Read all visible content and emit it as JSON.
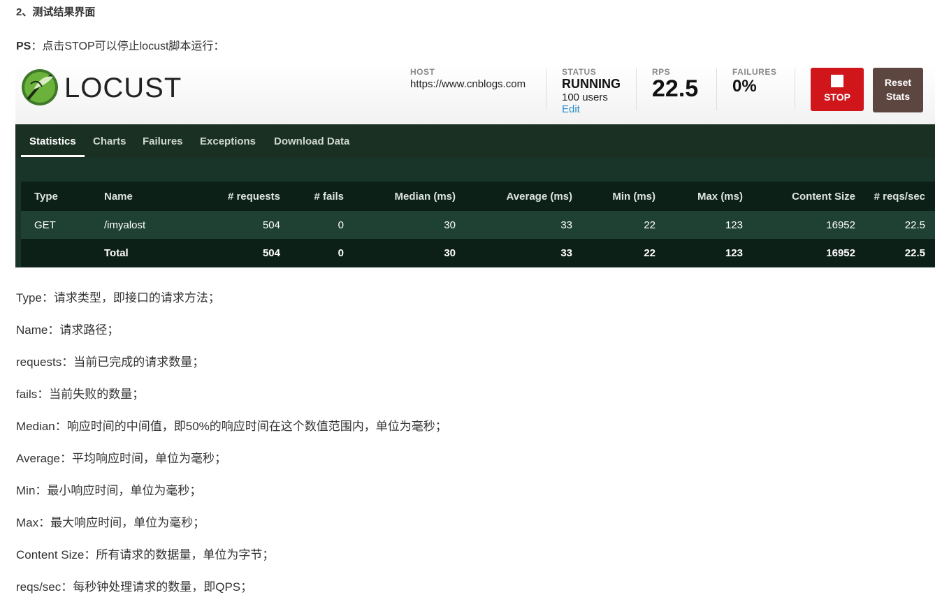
{
  "article": {
    "heading": "2、测试结果界面",
    "ps_label": "PS",
    "ps_text": "：点击STOP可以停止locust脚本运行："
  },
  "locust": {
    "logo_text": "LOCUST",
    "host": {
      "label": "HOST",
      "value": "https://www.cnblogs.com"
    },
    "status": {
      "label": "STATUS",
      "value": "RUNNING",
      "users": "100 users",
      "edit": "Edit"
    },
    "rps": {
      "label": "RPS",
      "value": "22.5"
    },
    "failures": {
      "label": "FAILURES",
      "value": "0%"
    },
    "stop_label": "STOP",
    "reset_label_1": "Reset",
    "reset_label_2": "Stats",
    "tabs": [
      "Statistics",
      "Charts",
      "Failures",
      "Exceptions",
      "Download Data"
    ],
    "table": {
      "headers": [
        "Type",
        "Name",
        "# requests",
        "# fails",
        "Median (ms)",
        "Average (ms)",
        "Min (ms)",
        "Max (ms)",
        "Content Size",
        "# reqs/sec"
      ],
      "rows": [
        [
          "GET",
          "/imyalost",
          "504",
          "0",
          "30",
          "33",
          "22",
          "123",
          "16952",
          "22.5"
        ]
      ],
      "total": [
        "",
        "Total",
        "504",
        "0",
        "30",
        "33",
        "22",
        "123",
        "16952",
        "22.5"
      ]
    }
  },
  "descriptions": [
    "Type：请求类型，即接口的请求方法；",
    "Name：请求路径；",
    "requests：当前已完成的请求数量；",
    "fails：当前失败的数量；",
    "Median：响应时间的中间值，即50%的响应时间在这个数值范围内，单位为毫秒；",
    "Average：平均响应时间，单位为毫秒；",
    "Min：最小响应时间，单位为毫秒；",
    "Max：最大响应时间，单位为毫秒；",
    "Content Size：所有请求的数据量，单位为字节；",
    "reqs/sec：每秒钟处理请求的数量，即QPS；"
  ],
  "colors": {
    "stop": "#d0151b",
    "reset": "#5d4640",
    "nav_bg": "#1a3023",
    "content_bg": "#19352a",
    "link": "#2a8ccb"
  }
}
